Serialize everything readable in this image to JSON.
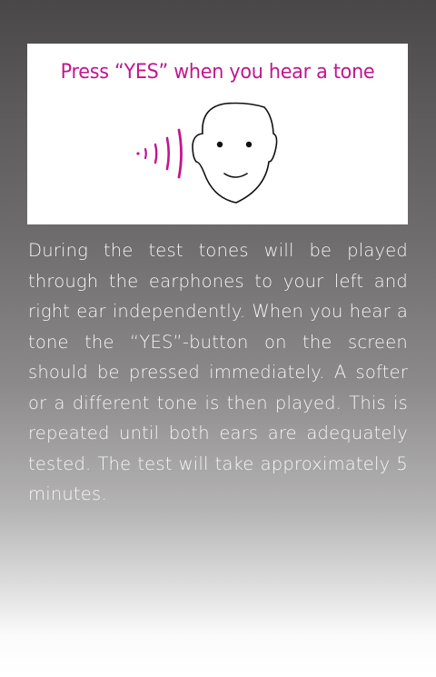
{
  "card": {
    "heading": "Press “YES” when you hear a tone"
  },
  "description": "During the test tones will be played through the earphones to your left and right ear independently. When you hear a tone the “YES”-button on the screen should be pressed immediately. A softer or a different tone is then played. This is repeated until both ears are adequately tested. The test will take approximately 5 minutes.",
  "colors": {
    "accent": "#c0168f",
    "text": "#f6f6f6"
  },
  "icons": {
    "sound": "sound-waves-icon",
    "face": "face-icon"
  }
}
